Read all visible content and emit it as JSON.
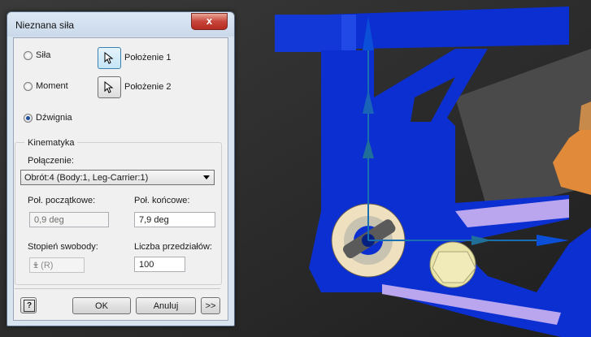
{
  "dialog": {
    "title": "Nieznana siła",
    "close_glyph": "x"
  },
  "mode": {
    "options": [
      {
        "label": "Siła",
        "checked": false
      },
      {
        "label": "Moment",
        "checked": false
      },
      {
        "label": "Dźwignia",
        "checked": true
      }
    ]
  },
  "pick": {
    "position1_label": "Położenie 1",
    "position2_label": "Położenie 2",
    "icon": "cursor-arrow-icon"
  },
  "kinematics": {
    "group_title": "Kinematyka",
    "connection_label": "Połączenie:",
    "connection_value": "Obrót:4 (Body:1, Leg-Carrier:1)",
    "start_pos_label": "Poł. początkowe:",
    "start_pos_value": "0,9 deg",
    "end_pos_label": "Poł. końcowe:",
    "end_pos_value": "7,9 deg",
    "dof_label": "Stopień swobody:",
    "dof_value": "1 (R)",
    "intervals_label": "Liczba przedziałów:",
    "intervals_value": "100"
  },
  "buttons": {
    "help": "?",
    "ok": "OK",
    "cancel": "Anuluj",
    "more": ">>"
  },
  "colors": {
    "viewport_bg": "#2a2a2a",
    "model_blue": "#0b2fd1",
    "model_orange": "#e08a3a",
    "bushing_beige": "#efe0bf",
    "bolt_yellow": "#e9e4a8",
    "triad_blue": "#0a55a8",
    "dialog_frame": "#d9e4f1"
  }
}
